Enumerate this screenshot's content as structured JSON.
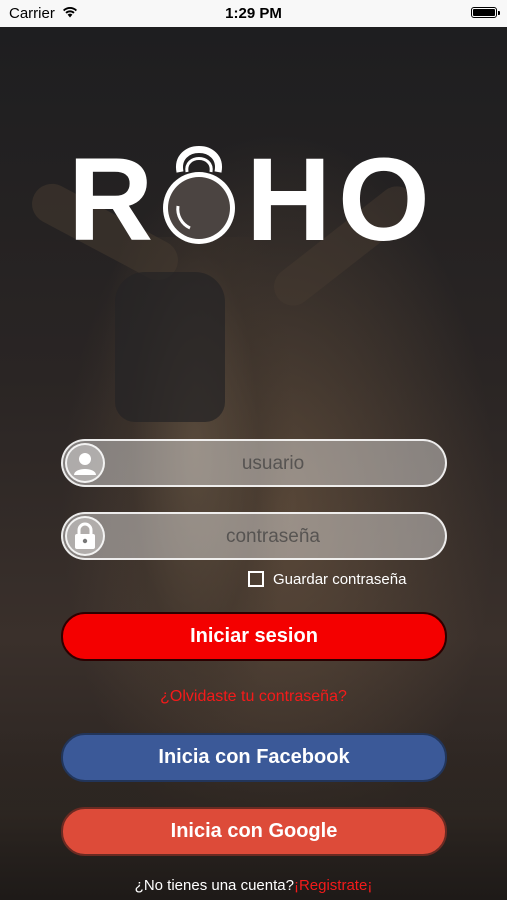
{
  "status_bar": {
    "carrier": "Carrier",
    "time": "1:29 PM"
  },
  "logo": {
    "letter1": "R",
    "letter3": "H",
    "letter4": "O"
  },
  "form": {
    "username_placeholder": "usuario",
    "password_placeholder": "contraseña",
    "remember_label": "Guardar contraseña"
  },
  "buttons": {
    "login": "Iniciar sesion",
    "facebook": "Inicia con Facebook",
    "google": "Inicia con Google"
  },
  "links": {
    "forgot": "¿Olvidaste tu contraseña?",
    "no_account": "¿No tienes una cuenta?",
    "register": "¡Registrate¡"
  },
  "colors": {
    "login": "#f40000",
    "facebook": "#3b5998",
    "google": "#dd4b39",
    "link": "#f51a1a"
  },
  "icons": [
    "wifi-icon",
    "battery-icon",
    "user-icon",
    "lock-icon",
    "kettlebell-logo-icon",
    "checkbox-icon"
  ]
}
